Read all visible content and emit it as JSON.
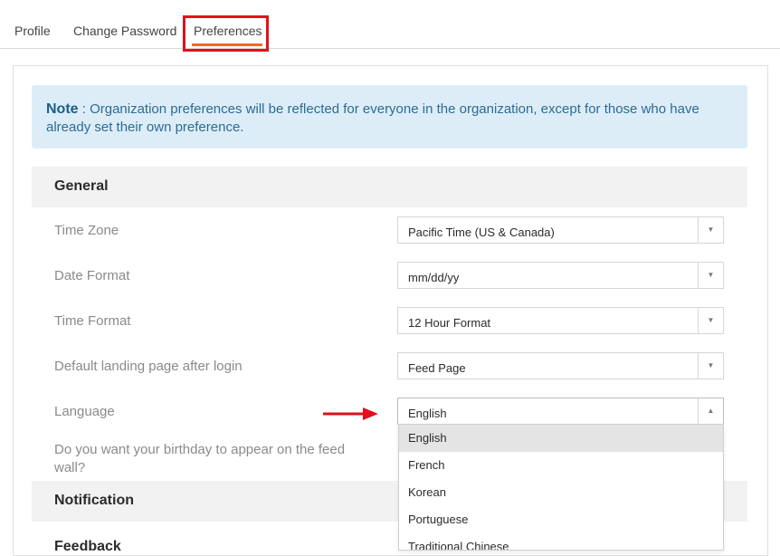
{
  "tabs": [
    {
      "label": "Profile"
    },
    {
      "label": "Change Password"
    },
    {
      "label": "Preferences"
    }
  ],
  "note": {
    "prefix": "Note",
    "text": " : Organization preferences will be reflected for everyone in the organization, except for those who have already set their own preference."
  },
  "sections": {
    "general": "General",
    "notification": "Notification",
    "feedback": "Feedback"
  },
  "settings": [
    {
      "label": "Time Zone",
      "value": "Pacific Time (US & Canada)"
    },
    {
      "label": "Date Format",
      "value": "mm/dd/yy"
    },
    {
      "label": "Time Format",
      "value": "12 Hour Format"
    },
    {
      "label": "Default landing page after login",
      "value": "Feed Page"
    },
    {
      "label": "Language",
      "value": "English"
    }
  ],
  "birthday_label": "Do you want your birthday to appear on the feed wall?",
  "language_options": [
    "English",
    "French",
    "Korean",
    "Portuguese",
    "Traditional Chinese"
  ],
  "selected_option": "English",
  "colors": {
    "accent_underline": "#ee6b2a",
    "highlight_box": "#e0111b",
    "note_bg": "#dcedf8",
    "note_text": "#2d6b92"
  },
  "icons": {
    "dropdown_closed": "caret-down-icon",
    "dropdown_open": "caret-up-icon",
    "annotation": "red-arrow-icon"
  }
}
